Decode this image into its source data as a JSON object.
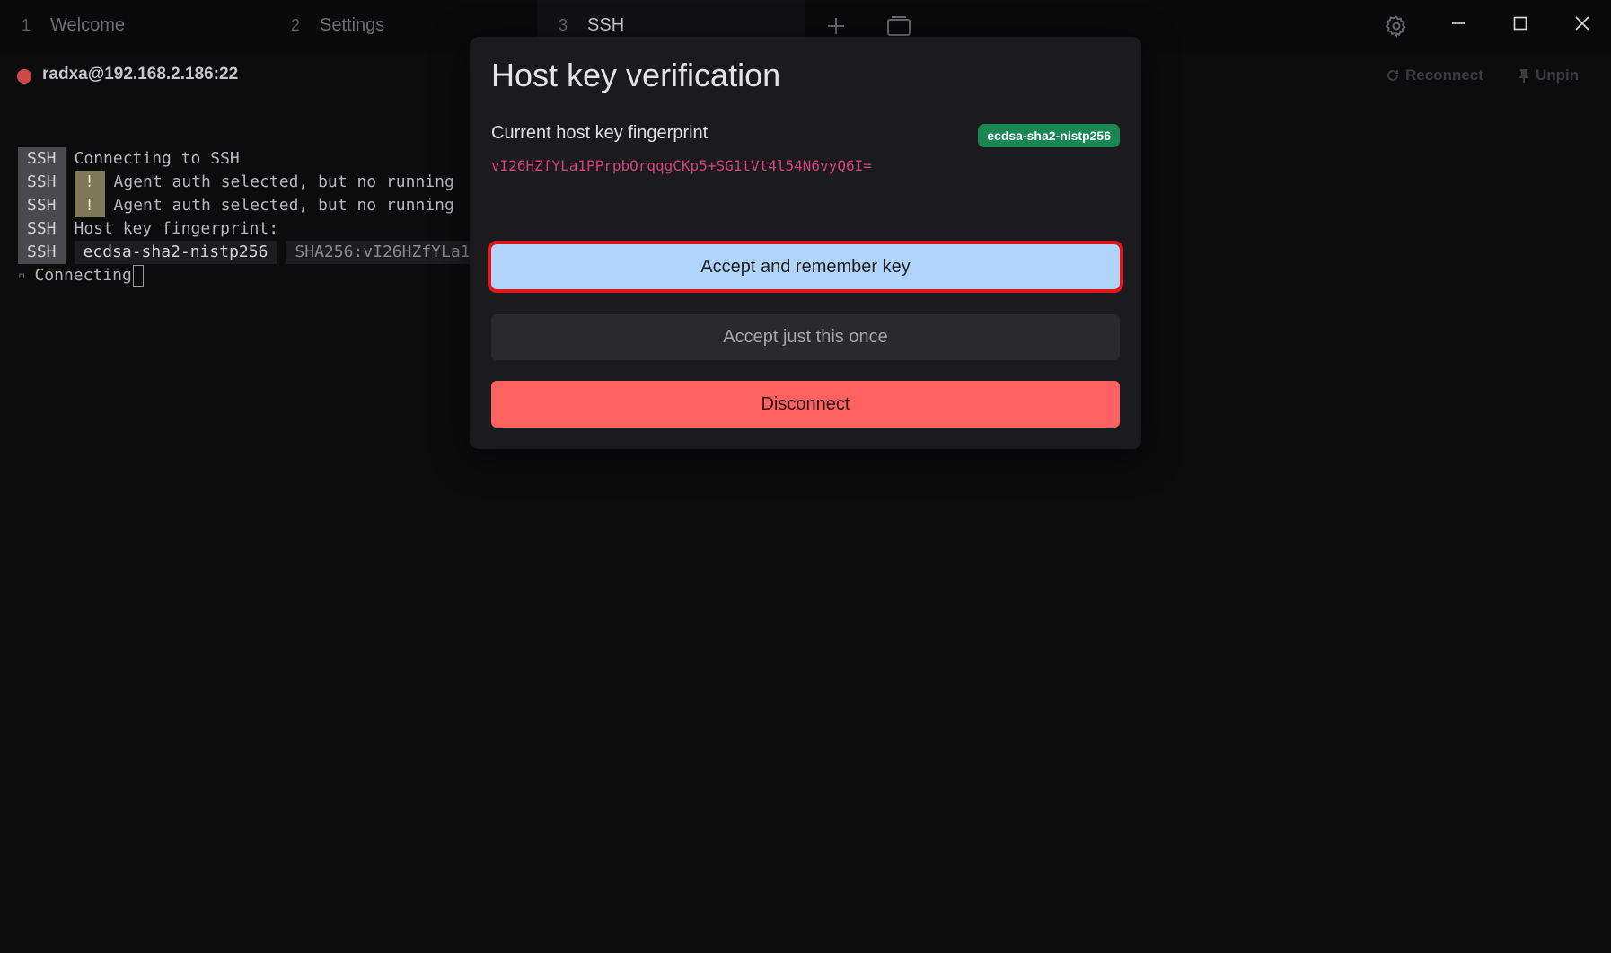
{
  "tabs": [
    {
      "number": "1",
      "label": "Welcome"
    },
    {
      "number": "2",
      "label": "Settings"
    },
    {
      "number": "3",
      "label": "SSH"
    }
  ],
  "session": {
    "host": "radxa@192.168.2.186:22",
    "status_color": "#cf4848",
    "reconnect_label": "Reconnect",
    "unpin_label": "Unpin"
  },
  "terminal": {
    "tag": "SSH",
    "warn_glyph": "!",
    "lines": {
      "connecting_ssh": "Connecting to SSH",
      "agent_warn_1": "Agent auth selected, but no running",
      "agent_warn_2": "Agent auth selected, but no running",
      "fingerprint_label": "Host key fingerprint:",
      "key_type": "ecdsa-sha2-nistp256",
      "key_hash": "SHA256:vI26HZfYLa1",
      "status": "Connecting"
    }
  },
  "modal": {
    "title": "Host key verification",
    "fingerprint_label": "Current host key fingerprint",
    "key_type": "ecdsa-sha2-nistp256",
    "fingerprint": "vI26HZfYLa1PPrpbOrqqgCKp5+SG1tVt4l54N6vyQ6I=",
    "accept_remember": "Accept and remember key",
    "accept_once": "Accept just this once",
    "disconnect": "Disconnect"
  },
  "colors": {
    "accept_remember_bg": "#b1d4fa",
    "disconnect_bg": "#fe6260",
    "key_type_badge_bg": "#198754",
    "fingerprint_text": "#d0437d",
    "highlight_outline": "#e3161a"
  }
}
